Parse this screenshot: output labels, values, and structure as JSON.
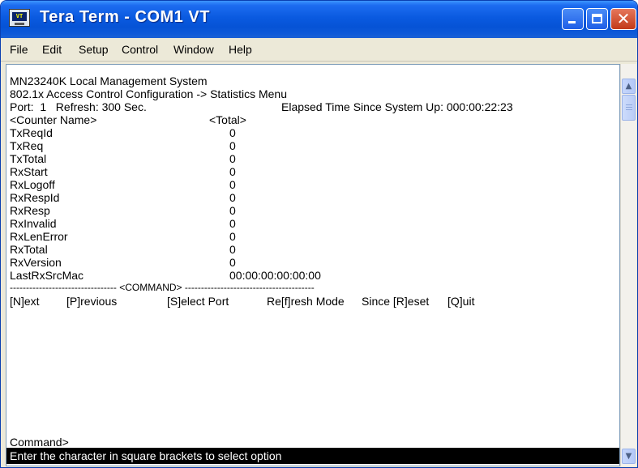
{
  "window": {
    "title": "Tera Term - COM1 VT",
    "icon_label": "VT",
    "title_buttons": {
      "minimize": "minimize-icon",
      "maximize": "maximize-icon",
      "close": "close-icon"
    }
  },
  "menu": {
    "items": [
      "File",
      "Edit",
      "Setup",
      "Control",
      "Window",
      "Help"
    ]
  },
  "terminal": {
    "system_name": "MN23240K Local Management System",
    "menu_path": "802.1x Access Control Configuration -> Statistics Menu",
    "port_line": "Port:  1   Refresh: 300 Sec.",
    "elapsed_line": "Elapsed Time Since System Up: 000:00:22:23",
    "columns": {
      "name": "<Counter Name>",
      "total": "<Total>"
    },
    "counters": [
      {
        "name": "TxReqId",
        "value": "0"
      },
      {
        "name": "TxReq",
        "value": "0"
      },
      {
        "name": "TxTotal",
        "value": "0"
      },
      {
        "name": "RxStart",
        "value": "0"
      },
      {
        "name": "RxLogoff",
        "value": "0"
      },
      {
        "name": "RxRespId",
        "value": "0"
      },
      {
        "name": "RxResp",
        "value": "0"
      },
      {
        "name": "RxInvalid",
        "value": "0"
      },
      {
        "name": "RxLenError",
        "value": "0"
      },
      {
        "name": "RxTotal",
        "value": "0"
      },
      {
        "name": "RxVersion",
        "value": "0"
      },
      {
        "name": "LastRxSrcMac",
        "value": "00:00:00:00:00:00"
      }
    ],
    "separator": "--------------------------------- <COMMAND> ----------------------------------------",
    "commands": [
      "[N]ext",
      "[P]revious",
      "[S]elect Port",
      "Re[f]resh Mode",
      "Since [R]eset",
      "[Q]uit"
    ],
    "prompt": "Command>",
    "status": "Enter the character in square brackets to select option"
  },
  "colors": {
    "title_bar": "#0a5ae0",
    "terminal_bg": "#ffffff",
    "terminal_fg": "#000000",
    "status_bg": "#000000",
    "close_button": "#c23a18"
  }
}
